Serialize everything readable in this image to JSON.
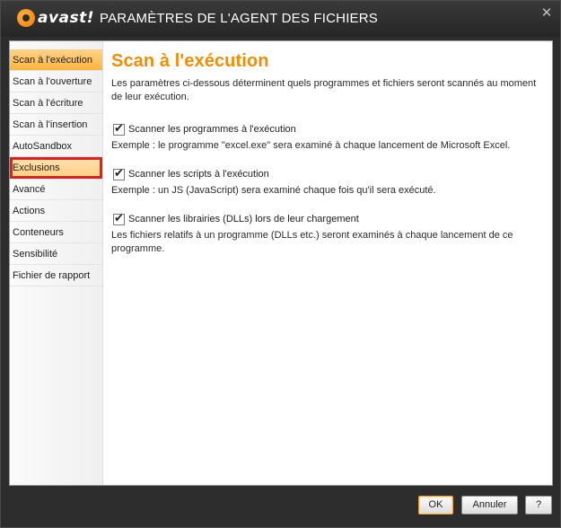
{
  "window": {
    "brand": "avast!",
    "title": "PARAMÈTRES DE L'AGENT DES FICHIERS",
    "close_glyph": "✕"
  },
  "sidebar": {
    "items": [
      {
        "label": "Scan à l'exécution",
        "state": "active"
      },
      {
        "label": "Scan à l'ouverture"
      },
      {
        "label": "Scan à l'écriture"
      },
      {
        "label": "Scan à l'insertion"
      },
      {
        "label": "AutoSandbox"
      },
      {
        "label": "Exclusions",
        "state": "highlighted"
      },
      {
        "label": "Avancé"
      },
      {
        "label": "Actions"
      },
      {
        "label": "Conteneurs"
      },
      {
        "label": "Sensibilité"
      },
      {
        "label": "Fichier de rapport"
      }
    ]
  },
  "main": {
    "heading": "Scan à l'exécution",
    "description": "Les paramètres ci-dessous déterminent quels programmes et fichiers seront scannés au moment de leur exécution.",
    "options": [
      {
        "label": "Scanner les programmes à l'exécution",
        "checked": true,
        "help": "Exemple : le programme \"excel.exe\" sera examiné à chaque lancement de Microsoft Excel."
      },
      {
        "label": "Scanner les scripts à l'exécution",
        "checked": true,
        "help": "Exemple : un JS (JavaScript) sera examiné chaque fois qu'il sera exécuté."
      },
      {
        "label": "Scanner les librairies (DLLs) lors de leur chargement",
        "checked": true,
        "help": "Les fichiers relatifs à un programme (DLLs etc.) seront examinés à chaque lancement de ce programme."
      }
    ]
  },
  "footer": {
    "ok_label": "OK",
    "cancel_label": "Annuler",
    "help_label": "?"
  },
  "colors": {
    "accent": "#f48c00",
    "highlight_border": "#e02020",
    "titlebar": "#2d2d2d"
  }
}
